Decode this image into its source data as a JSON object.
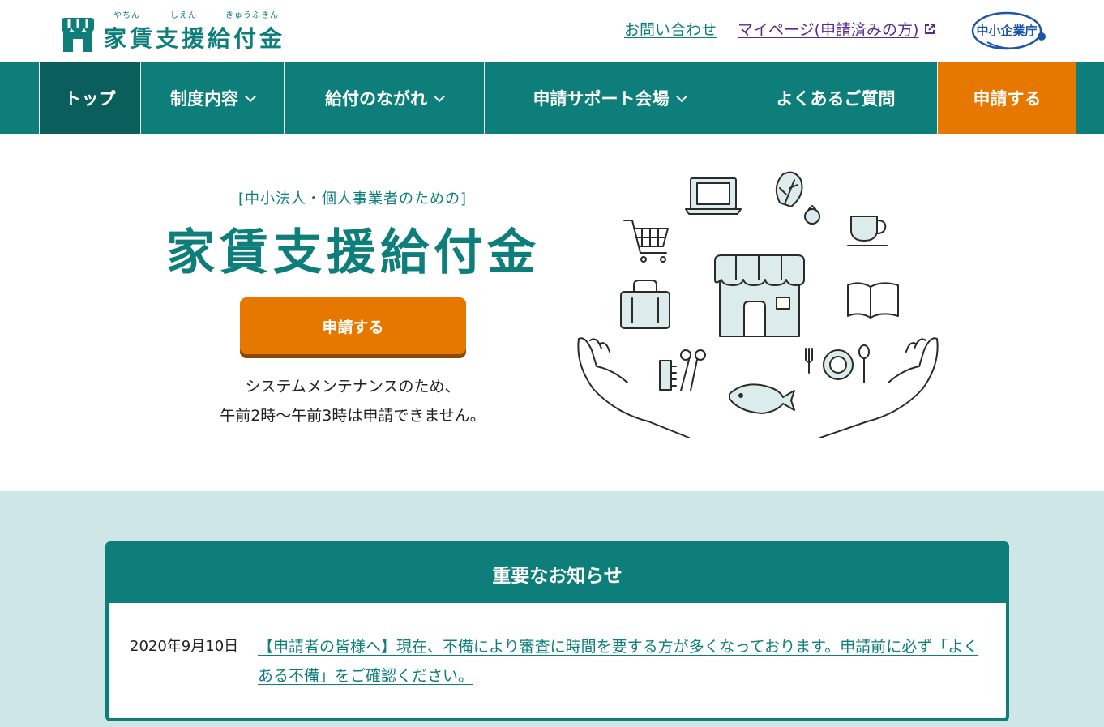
{
  "header": {
    "logo_ruby": [
      "やちん",
      "しえん",
      "きゅうふきん"
    ],
    "logo_title": "家賃支援給付金",
    "contact_link": "お問い合わせ",
    "mypage_link": "マイページ(申請済みの方)",
    "agency_label": "中小企業庁"
  },
  "nav": {
    "items": [
      {
        "label": "トップ",
        "dropdown": false,
        "active": true
      },
      {
        "label": "制度内容",
        "dropdown": true
      },
      {
        "label": "給付のながれ",
        "dropdown": true
      },
      {
        "label": "申請サポート会場",
        "dropdown": true
      },
      {
        "label": "よくあるご質問",
        "dropdown": false
      },
      {
        "label": "申請する",
        "dropdown": false
      }
    ]
  },
  "hero": {
    "subtitle": "[中小法人・個人事業者のための]",
    "title": "家賃支援給付金",
    "apply_button": "申請する",
    "note_line1": "システムメンテナンスのため、",
    "note_line2": "午前2時〜午前3時は申請できません。"
  },
  "notice": {
    "heading": "重要なお知らせ",
    "items": [
      {
        "date": "2020年9月10日",
        "text": "【申請者の皆様へ】現在、不備により審査に時間を要する方が多くなっております。申請前に必ず「よくある不備」をご確認ください。"
      }
    ]
  },
  "colors": {
    "primary": "#0d7e7a",
    "primary_dark": "#0a5f5d",
    "accent": "#e67800",
    "notice_bg": "#cfe6e7",
    "mypage_link": "#5a2a8a"
  },
  "icons": [
    "shop-logo-icon",
    "external-link-icon",
    "chevron-down-icon",
    "shop-illustration"
  ]
}
